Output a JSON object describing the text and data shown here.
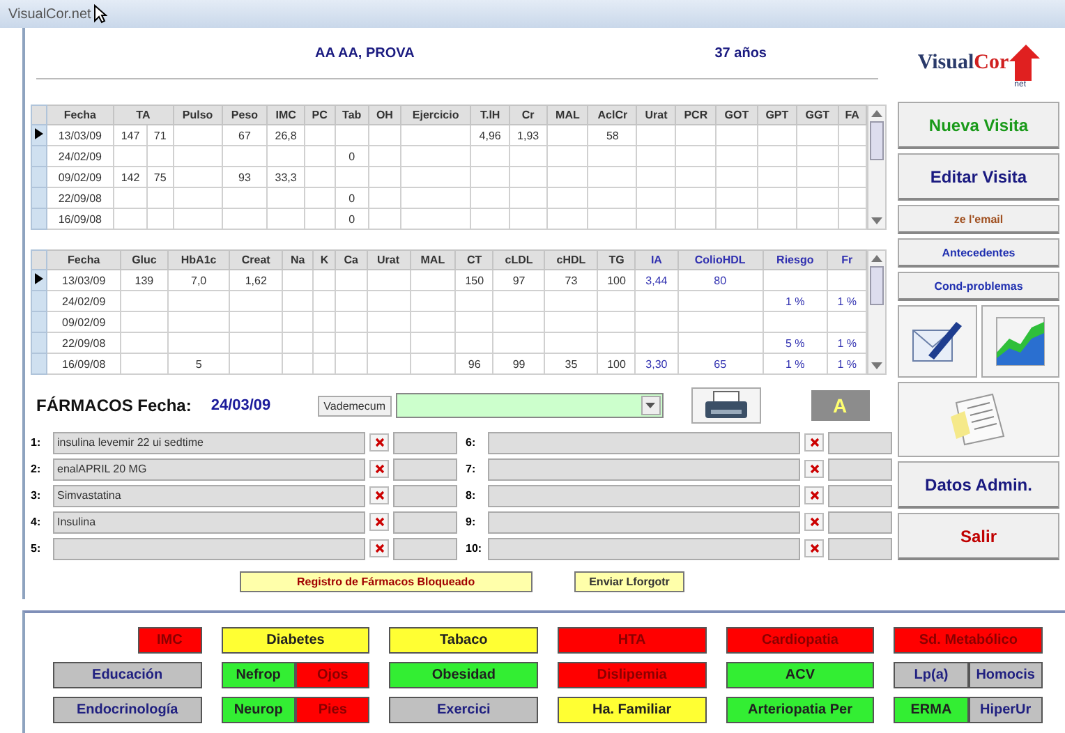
{
  "window": {
    "title": "VisualCor.net"
  },
  "patient": {
    "name": "AA AA, PROVA",
    "age": "37 años"
  },
  "logo": {
    "name": "Visual",
    "accent": "Cor",
    "suffix": "net"
  },
  "visits_table": {
    "headers": [
      {
        "label": "Fecha",
        "kind": "lab"
      },
      {
        "label": "TA",
        "kind": "pair"
      },
      {
        "label": "Pulso",
        "kind": "lab"
      },
      {
        "label": "Peso",
        "kind": "lab"
      },
      {
        "label": "IMC",
        "kind": "lab"
      },
      {
        "label": "PC",
        "kind": "lab"
      },
      {
        "label": "Tab",
        "kind": "lab"
      },
      {
        "label": "OH",
        "kind": "lab"
      },
      {
        "label": "Ejercicio",
        "kind": "lab"
      },
      {
        "label": "T.lH",
        "kind": "lab"
      },
      {
        "label": "Cr",
        "kind": "lab"
      },
      {
        "label": "MAL",
        "kind": "lab"
      },
      {
        "label": "AclCr",
        "kind": "lab"
      },
      {
        "label": "Urat",
        "kind": "lab"
      },
      {
        "label": "PCR",
        "kind": "lab"
      },
      {
        "label": "GOT",
        "kind": "lab"
      },
      {
        "label": "GPT",
        "kind": "lab"
      },
      {
        "label": "GGT",
        "kind": "lab"
      },
      {
        "label": "FA",
        "kind": "lab"
      }
    ],
    "rows": [
      {
        "selected": true,
        "cells": [
          "13/03/09",
          "147",
          "71",
          "",
          "67",
          "26,8",
          "",
          "",
          "",
          "",
          "4,96",
          "1,93",
          "",
          "58",
          "",
          "",
          "",
          "",
          "",
          ""
        ]
      },
      {
        "selected": false,
        "cells": [
          "24/02/09",
          "",
          "",
          "",
          "",
          "",
          "",
          "0",
          "",
          "",
          "",
          "",
          "",
          "",
          "",
          "",
          "",
          "",
          "",
          ""
        ]
      },
      {
        "selected": false,
        "cells": [
          "09/02/09",
          "142",
          "75",
          "",
          "93",
          "33,3",
          "",
          "",
          "",
          "",
          "",
          "",
          "",
          "",
          "",
          "",
          "",
          "",
          "",
          ""
        ]
      },
      {
        "selected": false,
        "cells": [
          "22/09/08",
          "",
          "",
          "",
          "",
          "",
          "",
          "0",
          "",
          "",
          "",
          "",
          "",
          "",
          "",
          "",
          "",
          "",
          "",
          ""
        ]
      },
      {
        "selected": false,
        "cells": [
          "16/09/08",
          "",
          "",
          "",
          "",
          "",
          "",
          "0",
          "",
          "",
          "",
          "",
          "",
          "",
          "",
          "",
          "",
          "",
          "",
          ""
        ]
      }
    ]
  },
  "lab_table": {
    "headers": [
      {
        "label": "Fecha",
        "kind": "lab"
      },
      {
        "label": "Gluc",
        "kind": "lab"
      },
      {
        "label": "HbA1c",
        "kind": "lab"
      },
      {
        "label": "Creat",
        "kind": "lab"
      },
      {
        "label": "Na",
        "kind": "lab"
      },
      {
        "label": "K",
        "kind": "lab"
      },
      {
        "label": "Ca",
        "kind": "lab"
      },
      {
        "label": "Urat",
        "kind": "lab"
      },
      {
        "label": "MAL",
        "kind": "lab"
      },
      {
        "label": "CT",
        "kind": "lab"
      },
      {
        "label": "cLDL",
        "kind": "lab"
      },
      {
        "label": "cHDL",
        "kind": "lab"
      },
      {
        "label": "TG",
        "kind": "lab"
      },
      {
        "label": "IA",
        "kind": "calc"
      },
      {
        "label": "ColioHDL",
        "kind": "calc"
      },
      {
        "label": "Riesgo",
        "kind": "calc"
      },
      {
        "label": "Fr",
        "kind": "calc"
      }
    ],
    "rows": [
      {
        "selected": true,
        "cells": [
          "13/03/09",
          "139",
          "7,0",
          "1,62",
          "",
          "",
          "",
          "",
          "",
          "150",
          "97",
          "73",
          "100",
          "3,44",
          "80",
          "",
          ""
        ]
      },
      {
        "selected": false,
        "cells": [
          "24/02/09",
          "",
          "",
          "",
          "",
          "",
          "",
          "",
          "",
          "",
          "",
          "",
          "",
          "",
          "",
          "1 %",
          "1 %"
        ]
      },
      {
        "selected": false,
        "cells": [
          "09/02/09",
          "",
          "",
          "",
          "",
          "",
          "",
          "",
          "",
          "",
          "",
          "",
          "",
          "",
          "",
          "",
          ""
        ]
      },
      {
        "selected": false,
        "cells": [
          "22/09/08",
          "",
          "",
          "",
          "",
          "",
          "",
          "",
          "",
          "",
          "",
          "",
          "",
          "",
          "",
          "5 %",
          "1 %"
        ]
      },
      {
        "selected": false,
        "cells": [
          "16/09/08",
          "",
          "5",
          "",
          "",
          "",
          "",
          "",
          "",
          "96",
          "99",
          "35",
          "100",
          "3,30",
          "65",
          "1 %",
          "1 %"
        ]
      }
    ]
  },
  "drugs": {
    "title": "FÁRMACOS Fecha:",
    "date": "24/03/09",
    "vademecum_button": "Vademecum",
    "font_button": "A",
    "items": [
      {
        "number": "1:",
        "name": "insulina levemir 22 ui sedtime"
      },
      {
        "number": "2:",
        "name": "enalAPRIL 20 MG"
      },
      {
        "number": "3:",
        "name": "Simvastatina"
      },
      {
        "number": "4:",
        "name": "Insulina"
      },
      {
        "number": "5:"
      },
      {
        "number": "6:"
      },
      {
        "number": "7:"
      },
      {
        "number": "8:"
      },
      {
        "number": "9:"
      },
      {
        "number": "10:"
      }
    ],
    "locked_notice": "Registro de Fármacos Bloqueado",
    "send_button": "Enviar Lforgotr"
  },
  "side_buttons": [
    {
      "label": "Nueva Visita",
      "kind": "big",
      "color": "#1a9a1a"
    },
    {
      "label": "Editar Visita",
      "kind": "big",
      "color": "#1a1a80"
    },
    {
      "label": "ze l'email",
      "kind": "small",
      "color": "#a05020"
    },
    {
      "label": "Antecedentes",
      "kind": "small",
      "color": "#2030b0"
    },
    {
      "label": "Cond-problemas",
      "kind": "small",
      "color": "#2030b0"
    },
    {
      "kind": "icons"
    },
    {
      "kind": "doc"
    },
    {
      "label": "Datos Admin.",
      "kind": "big",
      "color": "#1a1a80"
    },
    {
      "label": "Salir",
      "kind": "big",
      "color": "#c00000"
    }
  ],
  "factors": [
    [
      [
        {
          "label": "IMC",
          "color": "#ff0000",
          "kind": "small"
        }
      ],
      [
        {
          "label": "Diabetes",
          "color": "#ffff33",
          "kind": "full"
        }
      ],
      [
        {
          "label": "Tabaco",
          "color": "#ffff33",
          "kind": "full"
        }
      ],
      [
        {
          "label": "HTA",
          "color": "#ff0000",
          "kind": "full"
        }
      ],
      [
        {
          "label": "Cardiopatia",
          "color": "#ff0000",
          "kind": "full"
        }
      ],
      [
        {
          "label": "Sd. Metabólico",
          "color": "#ff0000",
          "kind": "full"
        }
      ]
    ],
    [
      [
        {
          "label": "Educación",
          "color": "#c0c0c0",
          "kind": "full"
        }
      ],
      [
        {
          "label": "Nefrop",
          "color": "#33ee33",
          "kind": "full"
        },
        {
          "label": "Ojos",
          "color": "#ff0000",
          "kind": "full"
        }
      ],
      [
        {
          "label": "Obesidad",
          "color": "#33ee33",
          "kind": "full"
        }
      ],
      [
        {
          "label": "Dislipemia",
          "color": "#ff0000",
          "kind": "full"
        }
      ],
      [
        {
          "label": "ACV",
          "color": "#33ee33",
          "kind": "full"
        }
      ],
      [
        {
          "label": "Lp(a)",
          "color": "#c0c0c0",
          "kind": "full"
        },
        {
          "label": "Homocis",
          "color": "#c0c0c0",
          "kind": "full"
        }
      ]
    ],
    [
      [
        {
          "label": "Endocrinología",
          "color": "#c0c0c0",
          "kind": "full"
        }
      ],
      [
        {
          "label": "Neurop",
          "color": "#33ee33",
          "kind": "full"
        },
        {
          "label": "Pies",
          "color": "#ff0000",
          "kind": "full"
        }
      ],
      [
        {
          "label": "Exercici",
          "color": "#c0c0c0",
          "kind": "full"
        }
      ],
      [
        {
          "label": "Ha. Familiar",
          "color": "#ffff33",
          "kind": "full"
        }
      ],
      [
        {
          "label": "Arteriopatia Per",
          "color": "#33ee33",
          "kind": "full"
        }
      ],
      [
        {
          "label": "ERMA",
          "color": "#33ee33",
          "kind": "full"
        },
        {
          "label": "HiperUr",
          "color": "#c0c0c0",
          "kind": "full"
        }
      ]
    ]
  ]
}
